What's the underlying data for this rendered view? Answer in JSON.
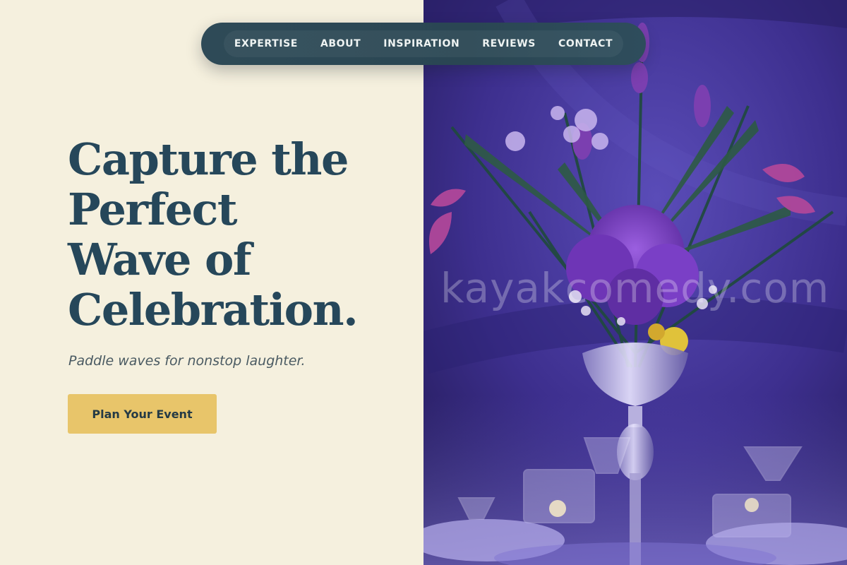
{
  "nav": {
    "items": [
      {
        "label": "EXPERTISE"
      },
      {
        "label": "ABOUT"
      },
      {
        "label": "INSPIRATION"
      },
      {
        "label": "REVIEWS"
      },
      {
        "label": "CONTACT"
      }
    ]
  },
  "hero": {
    "title_lines": [
      "Capture the",
      "Perfect",
      "Wave of",
      "Celebration."
    ],
    "subtitle": "Paddle waves for nonstop laughter.",
    "cta_label": "Plan Your Event"
  },
  "photo": {
    "watermark": "kayakcomedy.com",
    "subject": "purple floral centerpiece on event table"
  },
  "colors": {
    "background": "#f5f0de",
    "navbar": "#2a4653",
    "title": "#26475a",
    "cta": "#e8c56a",
    "photo_tone": "#4a3a9a"
  }
}
